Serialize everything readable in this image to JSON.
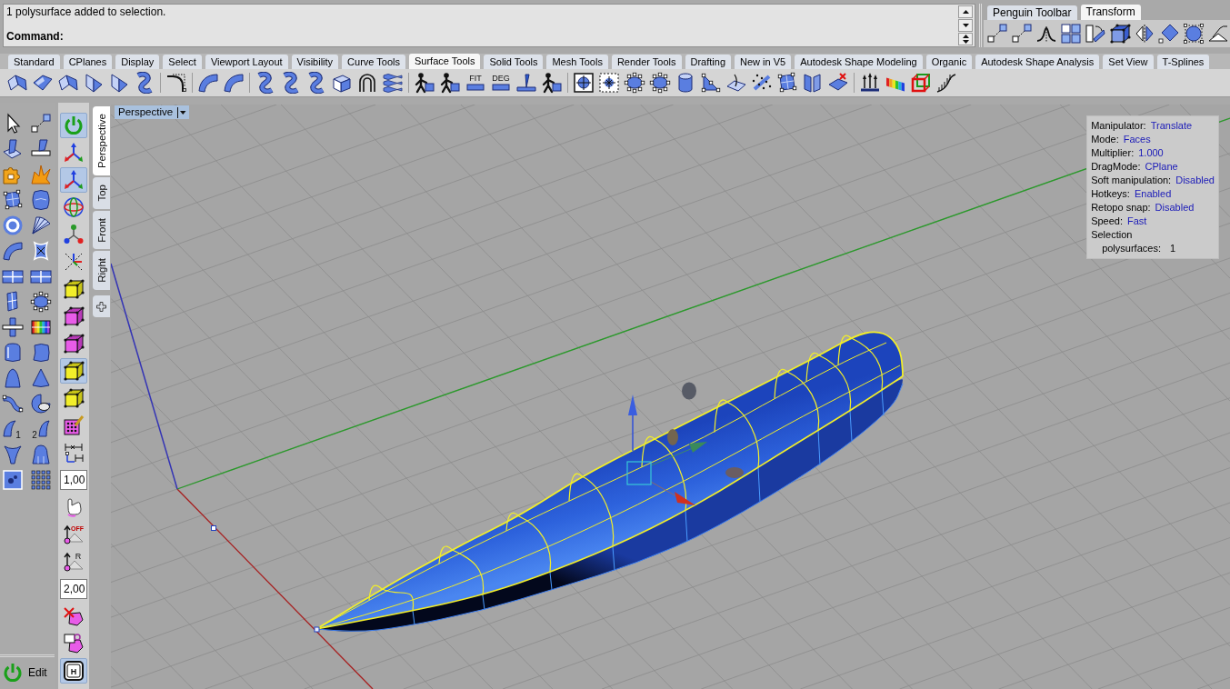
{
  "command_line": {
    "history": "1 polysurface added to selection.",
    "prompt": "Command:"
  },
  "side_toolbar": {
    "tabs": [
      {
        "label": "Penguin Toolbar",
        "selected": false
      },
      {
        "label": "Transform",
        "selected": true
      }
    ]
  },
  "toolbar_tabs": [
    {
      "label": "Standard",
      "selected": false
    },
    {
      "label": "CPlanes",
      "selected": false
    },
    {
      "label": "Display",
      "selected": false
    },
    {
      "label": "Select",
      "selected": false
    },
    {
      "label": "Viewport Layout",
      "selected": false
    },
    {
      "label": "Visibility",
      "selected": false
    },
    {
      "label": "Curve Tools",
      "selected": false
    },
    {
      "label": "Surface Tools",
      "selected": true
    },
    {
      "label": "Solid Tools",
      "selected": false
    },
    {
      "label": "Mesh Tools",
      "selected": false
    },
    {
      "label": "Render Tools",
      "selected": false
    },
    {
      "label": "Drafting",
      "selected": false
    },
    {
      "label": "New in V5",
      "selected": false
    },
    {
      "label": "Autodesk Shape Modeling",
      "selected": false
    },
    {
      "label": "Organic",
      "selected": false
    },
    {
      "label": "Autodesk Shape Analysis",
      "selected": false
    },
    {
      "label": "Set View",
      "selected": false
    },
    {
      "label": "T-Splines",
      "selected": false
    }
  ],
  "surface_toolbar": {
    "icon_texts": [
      "FIT",
      "DEG"
    ]
  },
  "main_toolbar": {
    "icon_texts": [
      "1",
      "2"
    ]
  },
  "gumball_toolbar": [
    {
      "kind": "button",
      "on": true
    },
    {
      "kind": "button",
      "on": false
    },
    {
      "kind": "button",
      "on": true
    },
    {
      "kind": "button",
      "on": false
    },
    {
      "kind": "button",
      "on": false
    },
    {
      "kind": "button",
      "on": false
    },
    {
      "kind": "button",
      "on": false
    },
    {
      "kind": "button",
      "on": false
    },
    {
      "kind": "button",
      "on": false
    },
    {
      "kind": "button",
      "on": true
    },
    {
      "kind": "button",
      "on": false
    },
    {
      "kind": "button",
      "on": false
    },
    {
      "kind": "button",
      "on": false
    },
    {
      "kind": "field",
      "value": "1,00"
    },
    {
      "kind": "button",
      "on": false
    },
    {
      "kind": "button",
      "on": false,
      "label": "OFF"
    },
    {
      "kind": "button",
      "on": false,
      "label": "R"
    },
    {
      "kind": "field",
      "value": "2,00"
    },
    {
      "kind": "button",
      "on": false
    },
    {
      "kind": "button",
      "on": false
    },
    {
      "kind": "button",
      "on": true,
      "label": "H"
    }
  ],
  "edit_button": {
    "label": "Edit"
  },
  "viewport_tabs": [
    {
      "label": "Perspective",
      "selected": true
    },
    {
      "label": "Top",
      "selected": false
    },
    {
      "label": "Front",
      "selected": false
    },
    {
      "label": "Right",
      "selected": false
    }
  ],
  "viewport": {
    "title": "Perspective",
    "info_panel": {
      "rows": [
        {
          "label": "Manipulator:",
          "value": "Translate"
        },
        {
          "label": "Mode:",
          "value": "Faces"
        },
        {
          "label": "Multiplier:",
          "value": "1.000"
        },
        {
          "label": "DragMode:",
          "value": "CPlane"
        },
        {
          "label": "Soft manipulation:",
          "value": "Disabled"
        },
        {
          "label": "Hotkeys:",
          "value": "Enabled"
        },
        {
          "label": "Retopo snap:",
          "value": "Disabled"
        },
        {
          "label": "Speed:",
          "value": "Fast"
        }
      ],
      "selection": {
        "heading": "Selection",
        "items": [
          {
            "label": "polysurfaces:",
            "count": "1"
          }
        ]
      }
    }
  }
}
